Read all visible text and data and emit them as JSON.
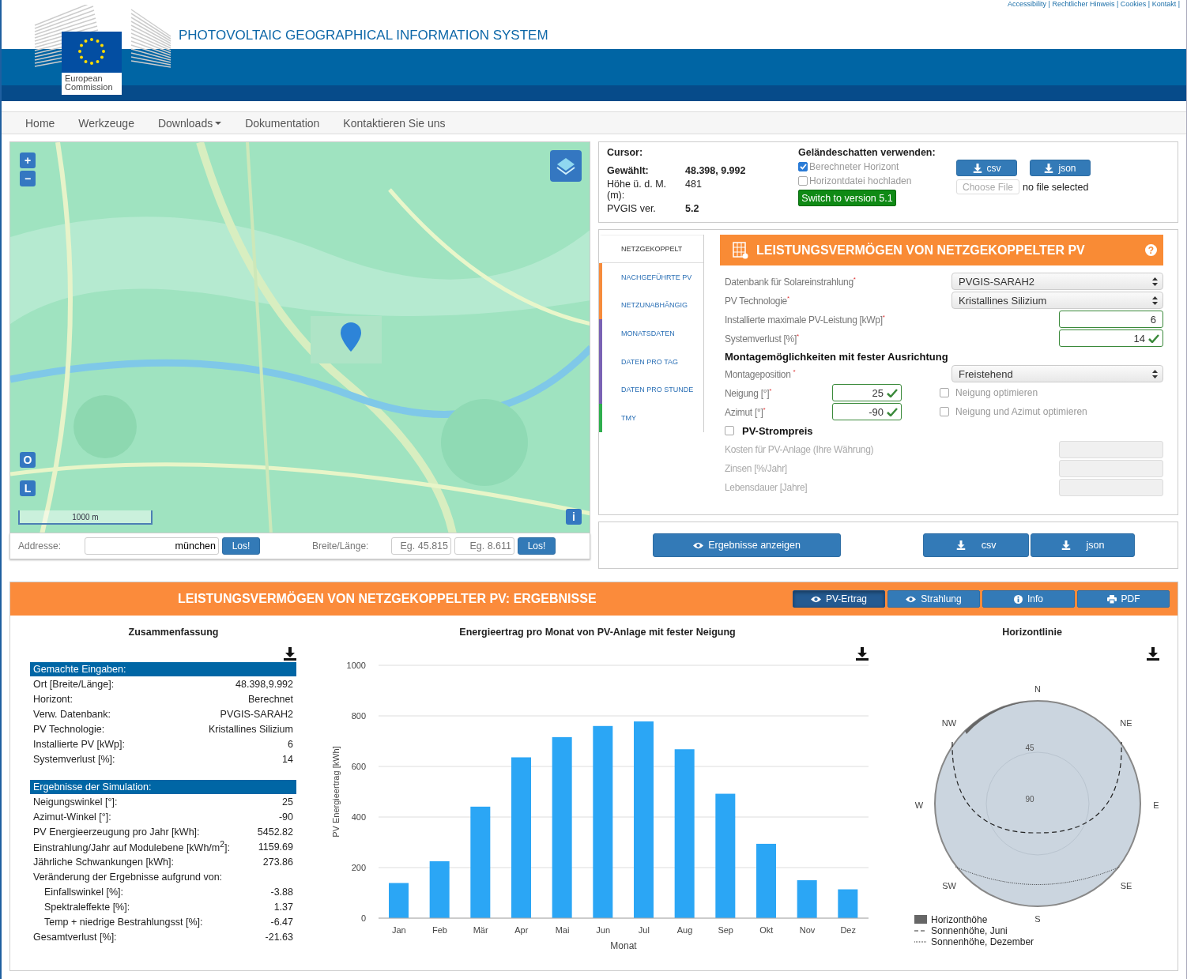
{
  "header": {
    "top_links": "Accessibility | Rechtlicher Hinweis | Cookies | Kontakt |",
    "logo_text": "European Commission",
    "title": "PHOTOVOLTAIC GEOGRAPHICAL INFORMATION SYSTEM"
  },
  "nav": [
    {
      "label": "Home",
      "dropdown": false
    },
    {
      "label": "Werkzeuge",
      "dropdown": false
    },
    {
      "label": "Downloads",
      "dropdown": true
    },
    {
      "label": "Dokumentation",
      "dropdown": false
    },
    {
      "label": "Kontaktieren Sie uns",
      "dropdown": false
    }
  ],
  "map": {
    "kind": "picture",
    "zoom_in": "+",
    "zoom_out": "−",
    "layer_buttons": [
      "O",
      "L"
    ],
    "info": "i",
    "scale": "1000 m"
  },
  "search": {
    "address_label": "Addresse:",
    "address_value": "münchen",
    "address_go": "Los!",
    "latlon_label": "Breite/Länge:",
    "lat_placeholder": "Eg. 45.815",
    "lon_placeholder": "Eg. 8.611",
    "latlon_go": "Los!"
  },
  "location": {
    "cursor_label": "Cursor:",
    "rows": [
      {
        "label": "Gewählt:",
        "value": "48.398, 9.992",
        "label_bold": true,
        "value_bold": true
      },
      {
        "label": "Höhe ü. d. M. (m):",
        "value": "481",
        "label_bold": false,
        "value_bold": false
      },
      {
        "label": "PVGIS ver.",
        "value": "5.2",
        "label_bold": false,
        "value_bold": true
      }
    ]
  },
  "terrain": {
    "title": "Geländeschatten verwenden:",
    "options": [
      {
        "label": "Berechneter Horizont",
        "checked": true
      },
      {
        "label": "Horizontdatei hochladen",
        "checked": false
      }
    ],
    "switch_button": "Switch to version 5.1",
    "downloads": [
      "csv",
      "json"
    ],
    "file_button": "Choose File",
    "file_status": "no file selected"
  },
  "side_tabs": [
    {
      "label": "NETZGEKOPPELT",
      "selected": true
    },
    {
      "label": "NACHGEFÜHRTE PV",
      "selected": false,
      "color": "#f68b3c"
    },
    {
      "label": "NETZUNABHÄNGIG",
      "selected": false,
      "color": "#f68b3c"
    },
    {
      "label": "MONATSDATEN",
      "selected": false,
      "color": "#7a62b4"
    },
    {
      "label": "DATEN PRO TAG",
      "selected": false,
      "color": "#7a62b4"
    },
    {
      "label": "DATEN PRO STUNDE",
      "selected": false,
      "color": "#7a62b4"
    },
    {
      "label": "TMY",
      "selected": false,
      "color": "#2fae4e"
    }
  ],
  "form": {
    "title": "LEISTUNGSVERMÖGEN VON NETZGEKOPPELTER PV",
    "help": "?",
    "rows": [
      {
        "kind": "select",
        "label": "Datenbank für Solareinstrahlung$^{*}$",
        "value": "PVGIS-SARAH2"
      },
      {
        "kind": "select",
        "label": "PV Technologie$^{*}$",
        "value": "Kristallines Silizium"
      },
      {
        "kind": "number",
        "label": "Installierte maximale PV-Leistung [kWp]$^{*}$",
        "value": "6",
        "valid": false
      },
      {
        "kind": "number",
        "label": "Systemverlust [%]$^{*}$",
        "value": "14",
        "valid": true
      }
    ],
    "mounting": {
      "title": "Montagemöglichkeiten mit fester Ausrichtung",
      "position": {
        "label": "Montageposition $^{*}$",
        "value": "Freistehend"
      },
      "angles": [
        {
          "label": "Neigung [°]$^{*}$",
          "value": "25",
          "valid": true,
          "option": {
            "label": "Neigung optimieren",
            "checked": false
          }
        },
        {
          "label": "Azimut [°]$^{*}$",
          "value": "-90",
          "valid": true,
          "option": {
            "label": "Neigung und Azimut optimieren",
            "checked": false
          }
        }
      ]
    },
    "price": {
      "label": "PV-Strompreis",
      "checked": false,
      "disabled": true,
      "fields": [
        "Kosten für PV-Anlage (Ihre Währung)",
        "Zinsen [%/Jahr]",
        "Lebensdauer [Jahre]"
      ]
    }
  },
  "actions": {
    "show": "Ergebnisse anzeigen",
    "downloads": [
      "csv",
      "json"
    ]
  },
  "results": {
    "title": "LEISTUNGSVERMÖGEN VON NETZGEKOPPELTER PV: ERGEBNISSE",
    "views": [
      {
        "label": "PV-Ertrag",
        "kind": "eye",
        "selected": true
      },
      {
        "label": "Strahlung",
        "kind": "eye",
        "selected": false
      },
      {
        "label": "Info",
        "kind": "info",
        "selected": false
      },
      {
        "label": "PDF",
        "kind": "print",
        "selected": false
      }
    ],
    "summary": {
      "title": "Zusammenfassung",
      "sections": [
        {
          "title": "Gemachte Eingaben:",
          "rows": [
            {
              "label": "Ort [Breite/Länge]:",
              "value": "48.398,9.992"
            },
            {
              "label": "Horizont:",
              "value": "Berechnet"
            },
            {
              "label": "Verw. Datenbank:",
              "value": "PVGIS-SARAH2"
            },
            {
              "label": "PV Technologie:",
              "value": "Kristallines Silizium"
            },
            {
              "label": "Installierte PV [kWp]:",
              "value": "6"
            },
            {
              "label": "Systemverlust [%]:",
              "value": "14"
            }
          ]
        },
        {
          "title": "Ergebnisse der Simulation:",
          "rows": [
            {
              "label": "Neigungswinkel [°]:",
              "value": "25"
            },
            {
              "label": "Azimut-Winkel [°]:",
              "value": "-90"
            },
            {
              "label": "PV Energieerzeugung pro Jahr [kWh]:",
              "value": "5452.82"
            },
            {
              "label": "Einstrahlung/Jahr auf Modulebene [kWh/m$^{2}$]:",
              "value": "1159.69"
            },
            {
              "label": "Jährliche Schwankungen [kWh]:",
              "value": "273.86"
            },
            {
              "label": "Veränderung der Ergebnisse aufgrund von:",
              "children": [
                {
                  "label": "Einfallswinkel [%]:",
                  "value": "-3.88"
                },
                {
                  "label": "Spektraleffekte [%]:",
                  "value": "1.37"
                },
                {
                  "label": "Temp + niedrige Bestrahlungsst [%]:",
                  "value": "-6.47"
                }
              ]
            },
            {
              "label": "Gesamtverlust [%]:",
              "value": "-21.63"
            }
          ]
        }
      ]
    },
    "energy": {
      "chart_data": {
        "type": "bar",
        "title": "Energieertrag pro Monat von PV-Anlage mit fester Neigung",
        "xlabel": "Monat",
        "ylabel": "PV Energieertrag [kWh]",
        "categories": [
          "Jan",
          "Feb",
          "Mär",
          "Apr",
          "Mai",
          "Jun",
          "Jul",
          "Aug",
          "Sep",
          "Okt",
          "Nov",
          "Dez"
        ],
        "values": [
          139,
          225,
          441,
          636,
          716,
          760,
          778,
          668,
          492,
          294,
          150,
          114
        ],
        "ylim": [
          0,
          1000
        ],
        "yticks": [
          0,
          200,
          400,
          600,
          800,
          1000
        ],
        "grid": true
      }
    },
    "horizon": {
      "title": "Horizontlinie",
      "compass": [
        "N",
        "NE",
        "E",
        "SE",
        "S",
        "SW",
        "W",
        "NW"
      ],
      "rings": [
        "45",
        "90"
      ],
      "legend": [
        {
          "label": "Horizonthöhe",
          "kind": "area"
        },
        {
          "label": "Sonnenhöhe, Juni",
          "kind": "dashed"
        },
        {
          "label": "Sonnenhöhe, Dezember",
          "kind": "dotted"
        }
      ]
    }
  }
}
